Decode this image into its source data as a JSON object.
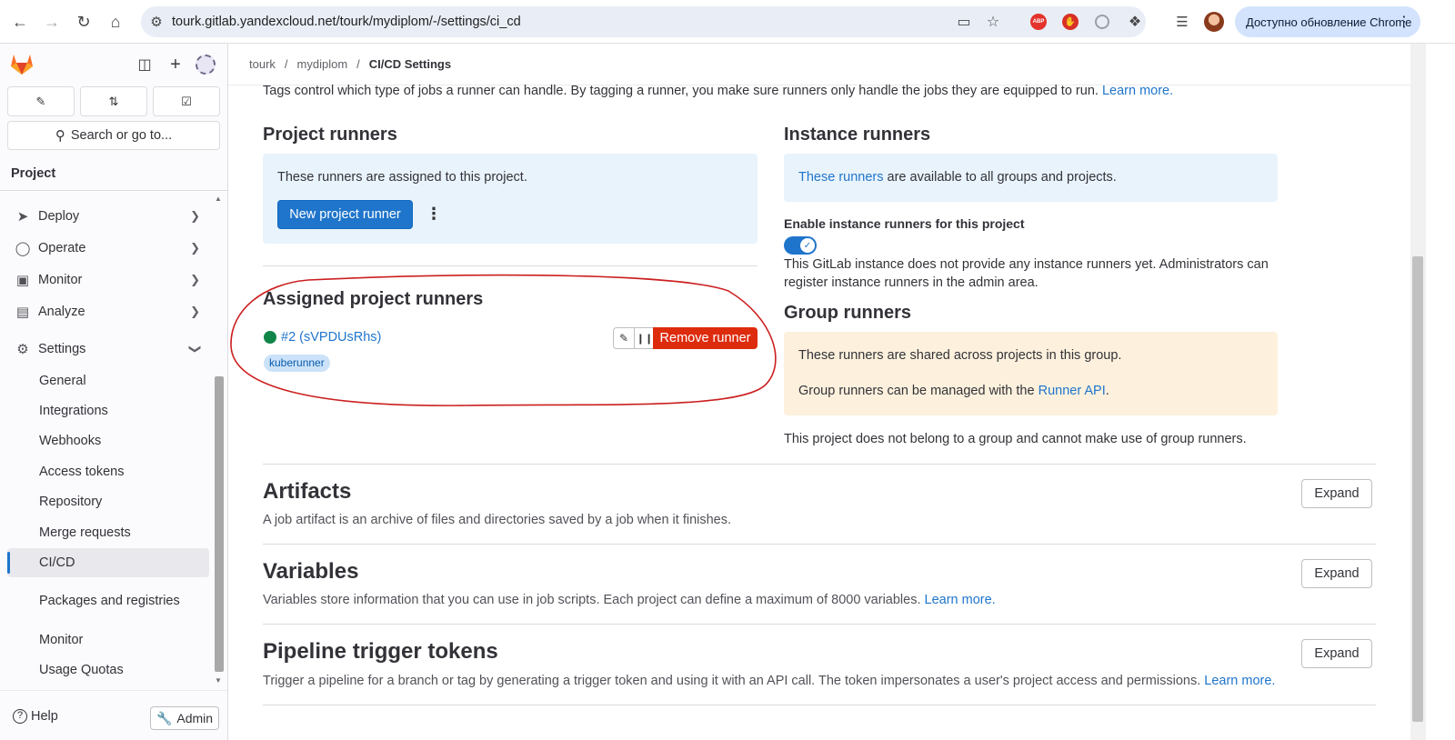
{
  "browser": {
    "url": "tourk.gitlab.yandexcloud.net/tourk/mydiplom/-/settings/ci_cd",
    "update_label": "Доступно обновление Chrome"
  },
  "sidebar": {
    "search_label": "Search or go to...",
    "section": "Project",
    "items": [
      {
        "label": "Deploy",
        "icon": "rocket-icon"
      },
      {
        "label": "Operate",
        "icon": "operate-icon"
      },
      {
        "label": "Monitor",
        "icon": "monitor-icon"
      },
      {
        "label": "Analyze",
        "icon": "chart-icon"
      },
      {
        "label": "Settings",
        "icon": "gear-icon"
      }
    ],
    "sub_items": [
      "General",
      "Integrations",
      "Webhooks",
      "Access tokens",
      "Repository",
      "Merge requests",
      "CI/CD",
      "Packages and registries",
      "Monitor",
      "Usage Quotas"
    ],
    "help_label": "Help",
    "admin_label": "Admin"
  },
  "breadcrumb": {
    "items": [
      "tourk",
      "mydiplom",
      "CI/CD Settings"
    ]
  },
  "intro": {
    "text": "Tags control which type of jobs a runner can handle. By tagging a runner, you make sure runners only handle the jobs they are equipped to run.",
    "link": "Learn more."
  },
  "project_runners": {
    "title": "Project runners",
    "info": "These runners are assigned to this project.",
    "new_button": "New project runner"
  },
  "assigned": {
    "title": "Assigned project runners",
    "runner_name": "#2 (sVPDUsRhs)",
    "tag": "kuberunner",
    "remove_button": "Remove runner"
  },
  "instance_runners": {
    "title": "Instance runners",
    "info_link": "These runners",
    "info_rest": "are available to all groups and projects.",
    "enable_label": "Enable instance runners for this project",
    "note_line1": "This GitLab instance does not provide any instance runners yet. Administrators can",
    "note_line2": "register instance runners in the admin area."
  },
  "group_runners": {
    "title": "Group runners",
    "info1": "These runners are shared across projects in this group.",
    "info2_pre": "Group runners can be managed with the",
    "info2_link": "Runner API",
    "info2_post": ".",
    "note": "This project does not belong to a group and cannot make use of group runners."
  },
  "sections": [
    {
      "title": "Artifacts",
      "desc": "A job artifact is an archive of files and directories saved by a job when it finishes.",
      "link": "",
      "button": "Expand"
    },
    {
      "title": "Variables",
      "desc": "Variables store information that you can use in job scripts. Each project can define a maximum of 8000 variables.",
      "link": "Learn more.",
      "button": "Expand"
    },
    {
      "title": "Pipeline trigger tokens",
      "desc": "Trigger a pipeline for a branch or tag by generating a trigger token and using it with an API call. The token impersonates a user's project access and permissions.",
      "link": "Learn more.",
      "button": "Expand"
    }
  ],
  "colors": {
    "primary": "#1f75cb",
    "danger": "#dd2b0e",
    "success": "#108548",
    "annotation": "#cc1f1f"
  }
}
